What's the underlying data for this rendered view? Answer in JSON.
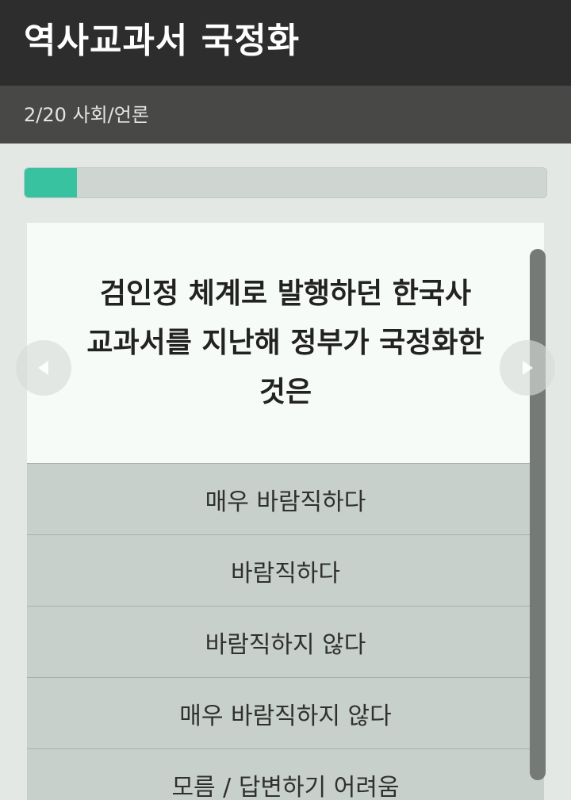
{
  "header": {
    "title": "역사교과서 국정화"
  },
  "subheader": {
    "progress_text": "2/20 사회/언론"
  },
  "progress": {
    "value_percent": 10,
    "fill_color": "#38c2a0"
  },
  "question": {
    "line1": "검인정 체계로 발행하던 한국사",
    "line2": "교과서를 지난해 정부가 국정화한",
    "line3": "것은"
  },
  "options": [
    {
      "label": "매우 바람직하다"
    },
    {
      "label": "바람직하다"
    },
    {
      "label": "바람직하지 않다"
    },
    {
      "label": "매우 바람직하지 않다"
    },
    {
      "label": "모름 / 답변하기 어려움"
    }
  ],
  "icons": {
    "prev": "chevron-left-icon",
    "next": "chevron-right-icon"
  }
}
